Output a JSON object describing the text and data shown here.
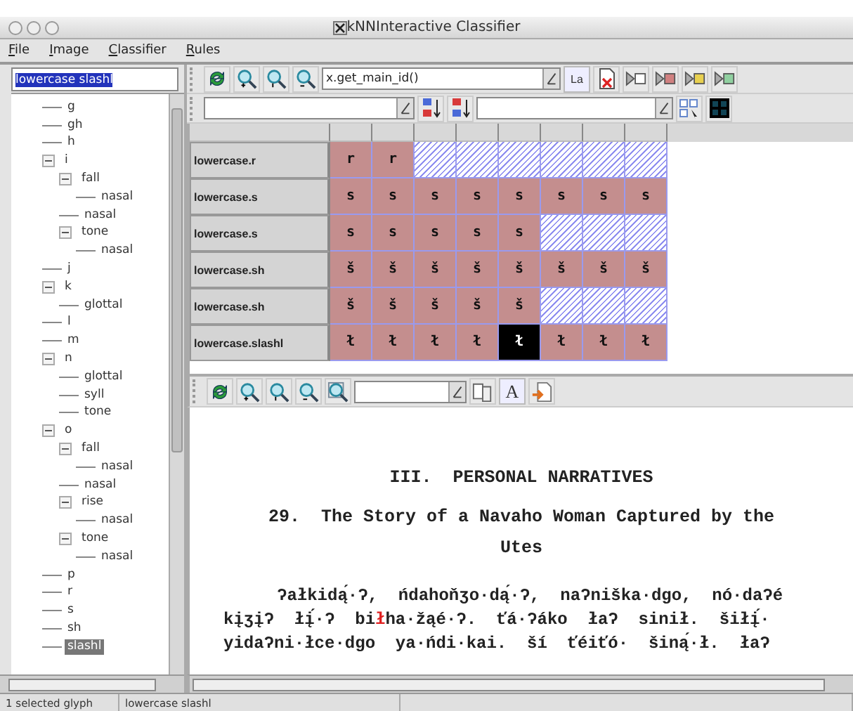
{
  "window": {
    "title": "kNNInteractive Classifier"
  },
  "menu": [
    "File",
    "Image",
    "Classifier",
    "Rules"
  ],
  "symbol_field": {
    "value": "lowercase slashl"
  },
  "tree": [
    {
      "label": "g",
      "selected": false
    },
    {
      "label": "gh",
      "selected": false
    },
    {
      "label": "h",
      "selected": false
    },
    {
      "label": "i",
      "selected": false,
      "expanded": true,
      "children": [
        {
          "label": "fall",
          "selected": false,
          "expanded": true,
          "children": [
            {
              "label": "nasal",
              "selected": false
            }
          ]
        },
        {
          "label": "nasal",
          "selected": false
        },
        {
          "label": "tone",
          "selected": false,
          "expanded": true,
          "children": [
            {
              "label": "nasal",
              "selected": false
            }
          ]
        }
      ]
    },
    {
      "label": "j",
      "selected": false
    },
    {
      "label": "k",
      "selected": false,
      "expanded": true,
      "children": [
        {
          "label": "glottal",
          "selected": false
        }
      ]
    },
    {
      "label": "l",
      "selected": false
    },
    {
      "label": "m",
      "selected": false
    },
    {
      "label": "n",
      "selected": false,
      "expanded": true,
      "children": [
        {
          "label": "glottal",
          "selected": false
        },
        {
          "label": "syll",
          "selected": false
        },
        {
          "label": "tone",
          "selected": false
        }
      ]
    },
    {
      "label": "o",
      "selected": false,
      "expanded": true,
      "children": [
        {
          "label": "fall",
          "selected": false,
          "expanded": true,
          "children": [
            {
              "label": "nasal",
              "selected": false
            }
          ]
        },
        {
          "label": "nasal",
          "selected": false
        },
        {
          "label": "rise",
          "selected": false,
          "expanded": true,
          "children": [
            {
              "label": "nasal",
              "selected": false
            }
          ]
        },
        {
          "label": "tone",
          "selected": false,
          "expanded": true,
          "children": [
            {
              "label": "nasal",
              "selected": false
            }
          ]
        }
      ]
    },
    {
      "label": "p",
      "selected": false
    },
    {
      "label": "r",
      "selected": false
    },
    {
      "label": "s",
      "selected": false
    },
    {
      "label": "sh",
      "selected": false
    },
    {
      "label": "slashl",
      "selected": true
    }
  ],
  "glyph_toolbar": {
    "expression": "x.get_main_id()",
    "label_button": "La"
  },
  "glyph_grid": {
    "rows": [
      {
        "label": "lowercase.r",
        "glyphs": [
          {
            "char": "r",
            "selected": false
          },
          {
            "char": "r",
            "selected": false
          }
        ]
      },
      {
        "label": "lowercase.s",
        "glyphs": [
          {
            "char": "s",
            "selected": false
          },
          {
            "char": "s",
            "selected": false
          },
          {
            "char": "s",
            "selected": false
          },
          {
            "char": "s",
            "selected": false
          },
          {
            "char": "s",
            "selected": false
          },
          {
            "char": "s",
            "selected": false
          },
          {
            "char": "s",
            "selected": false
          },
          {
            "char": "s",
            "selected": false
          }
        ]
      },
      {
        "label": "lowercase.s",
        "glyphs": [
          {
            "char": "s",
            "selected": false
          },
          {
            "char": "s",
            "selected": false
          },
          {
            "char": "s",
            "selected": false
          },
          {
            "char": "s",
            "selected": false
          },
          {
            "char": "s",
            "selected": false
          }
        ]
      },
      {
        "label": "lowercase.sh",
        "glyphs": [
          {
            "char": "š",
            "selected": false
          },
          {
            "char": "š",
            "selected": false
          },
          {
            "char": "š",
            "selected": false
          },
          {
            "char": "š",
            "selected": false
          },
          {
            "char": "š",
            "selected": false
          },
          {
            "char": "š",
            "selected": false
          },
          {
            "char": "š",
            "selected": false
          },
          {
            "char": "š",
            "selected": false
          }
        ]
      },
      {
        "label": "lowercase.sh",
        "glyphs": [
          {
            "char": "š",
            "selected": false
          },
          {
            "char": "š",
            "selected": false
          },
          {
            "char": "š",
            "selected": false
          },
          {
            "char": "š",
            "selected": false
          },
          {
            "char": "š",
            "selected": false
          }
        ]
      },
      {
        "label": "lowercase.slashl",
        "glyphs": [
          {
            "char": "ł",
            "selected": false
          },
          {
            "char": "ł",
            "selected": false
          },
          {
            "char": "ł",
            "selected": false
          },
          {
            "char": "ł",
            "selected": false
          },
          {
            "char": "ł",
            "selected": true
          },
          {
            "char": "ł",
            "selected": false
          },
          {
            "char": "ł",
            "selected": false
          },
          {
            "char": "ł",
            "selected": false
          }
        ]
      }
    ]
  },
  "document_toolbar": {
    "font_button": "A"
  },
  "document": {
    "heading": "III.  PERSONAL NARRATIVES",
    "title_lines": [
      "29.  The Story of a Navaho Woman Captured by the",
      "Utes"
    ],
    "lines": [
      {
        "kind": "indent",
        "parts": [
          {
            "text": "ʔałkidą́·ʔ,  ńdahoňʒo·dą́·ʔ,  naʔniška·dgo,  nó·daʔé",
            "highlighted": false
          }
        ]
      },
      {
        "kind": "plain",
        "parts": [
          {
            "text": "kįʒįʔ  łį́·ʔ  bi",
            "highlighted": false
          },
          {
            "text": "ł",
            "highlighted": true
          },
          {
            "text": "ha·žąé·ʔ.  ťá·ʔáko  łaʔ  sinił.  šiłį́·",
            "highlighted": false
          }
        ]
      },
      {
        "kind": "plain",
        "parts": [
          {
            "text": "yidaʔni·łce·dgo  ya·ńdi·kai.  ší  ťéiťó·  šiną́·ł.  łaʔ",
            "highlighted": false
          }
        ]
      }
    ]
  },
  "status_bar": [
    "1 selected glyph",
    "lowercase slashl"
  ]
}
